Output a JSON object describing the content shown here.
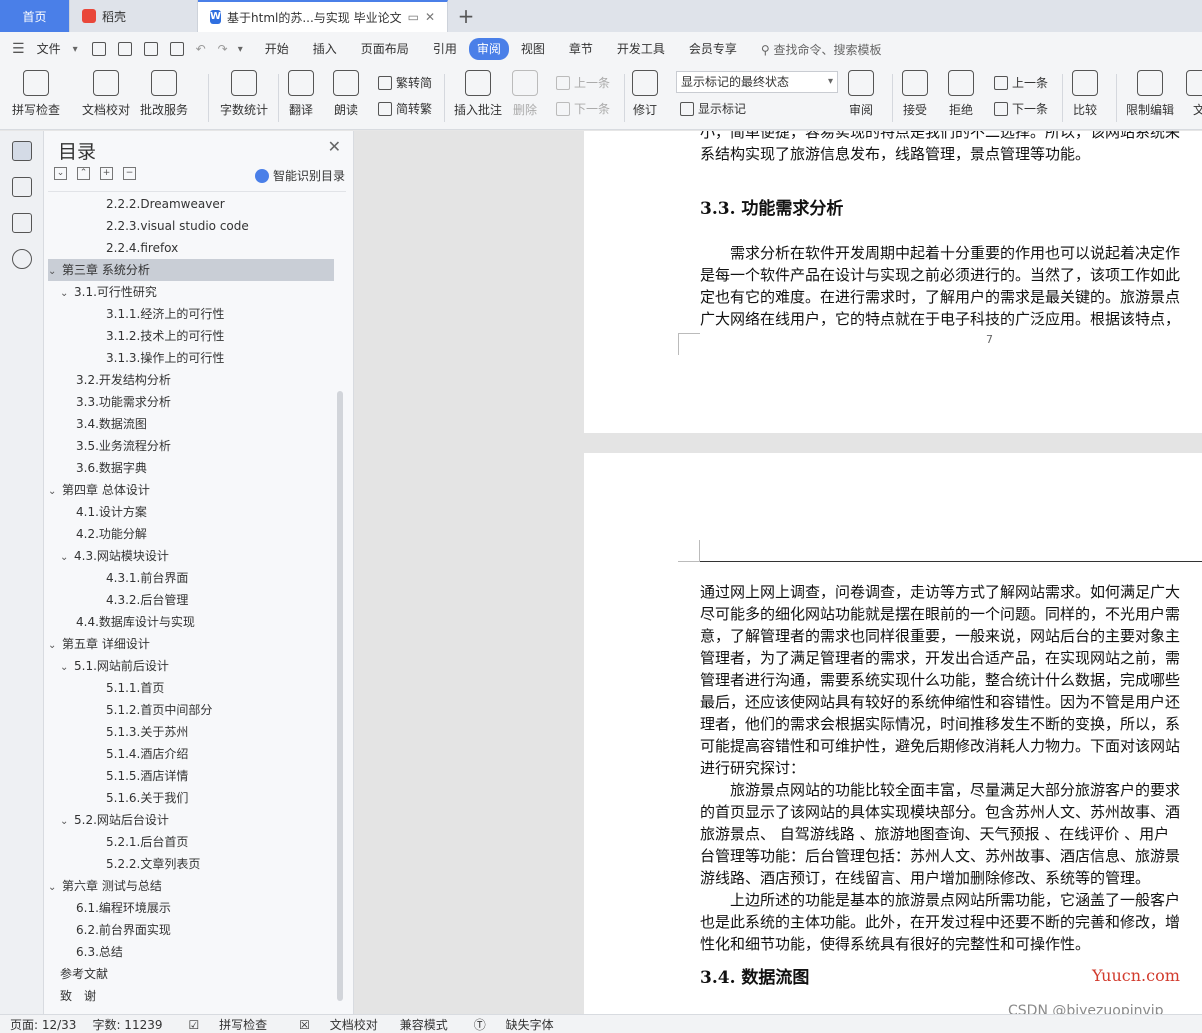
{
  "tabs": {
    "home": "首页",
    "daoke": "稻壳",
    "doc": "基于html的苏...与实现 毕业论文",
    "new": "+"
  },
  "menu": {
    "file": "文件",
    "items": [
      "开始",
      "插入",
      "页面布局",
      "引用",
      "审阅",
      "视图",
      "章节",
      "开发工具",
      "会员专享"
    ],
    "active": "审阅",
    "search": "查找命令、搜索模板"
  },
  "ribbon": {
    "spell": "拼写检查",
    "proof": "文档校对",
    "annotate": "批改服务",
    "wordcount": "字数统计",
    "translate": "翻译",
    "read": "朗读",
    "to_trad": "繁转简",
    "to_simp": "简转繁",
    "insert_comment": "插入批注",
    "delete": "删除",
    "prev1": "上一条",
    "next1": "下一条",
    "revise": "修订",
    "display_select": "显示标记的最终状态",
    "show_marks": "显示标记",
    "review": "审阅",
    "accept": "接受",
    "reject": "拒绝",
    "prev2": "上一条",
    "next2": "下一条",
    "compare": "比较",
    "restrict": "限制编辑",
    "doc_cut": "文"
  },
  "toc": {
    "title": "目录",
    "smart": "智能识别目录",
    "items": [
      {
        "label": "2.2.2.Dreamweaver",
        "level": 3
      },
      {
        "label": "2.2.3.visual studio code",
        "level": 3
      },
      {
        "label": "2.2.4.firefox",
        "level": 3
      },
      {
        "label": "第三章 系统分析",
        "level": 1,
        "selected": true,
        "arrow": "⌄"
      },
      {
        "label": "3.1.可行性研究",
        "level": 2,
        "arrow": "⌄"
      },
      {
        "label": "3.1.1.经济上的可行性",
        "level": 3
      },
      {
        "label": "3.1.2.技术上的可行性",
        "level": 3
      },
      {
        "label": "3.1.3.操作上的可行性",
        "level": 3
      },
      {
        "label": "3.2.开发结构分析",
        "level": 2
      },
      {
        "label": "3.3.功能需求分析",
        "level": 2
      },
      {
        "label": "3.4.数据流图",
        "level": 2
      },
      {
        "label": "3.5.业务流程分析",
        "level": 2
      },
      {
        "label": "3.6.数据字典",
        "level": 2
      },
      {
        "label": "第四章 总体设计",
        "level": 1,
        "arrow": "⌄"
      },
      {
        "label": "4.1.设计方案",
        "level": 2
      },
      {
        "label": "4.2.功能分解",
        "level": 2
      },
      {
        "label": "4.3.网站模块设计",
        "level": 2,
        "arrow": "⌄"
      },
      {
        "label": "4.3.1.前台界面",
        "level": 3
      },
      {
        "label": "4.3.2.后台管理",
        "level": 3
      },
      {
        "label": "4.4.数据库设计与实现",
        "level": 2
      },
      {
        "label": "第五章 详细设计",
        "level": 1,
        "arrow": "⌄"
      },
      {
        "label": "5.1.网站前后设计",
        "level": 2,
        "arrow": "⌄"
      },
      {
        "label": "5.1.1.首页",
        "level": 3
      },
      {
        "label": "5.1.2.首页中间部分",
        "level": 3
      },
      {
        "label": "5.1.3.关于苏州",
        "level": 3
      },
      {
        "label": "5.1.4.酒店介绍",
        "level": 3
      },
      {
        "label": "5.1.5.酒店详情",
        "level": 3
      },
      {
        "label": "5.1.6.关于我们",
        "level": 3
      },
      {
        "label": "5.2.网站后台设计",
        "level": 2,
        "arrow": "⌄"
      },
      {
        "label": "5.2.1.后台首页",
        "level": 3
      },
      {
        "label": "5.2.2.文章列表页",
        "level": 3
      },
      {
        "label": "第六章 测试与总结",
        "level": 1,
        "arrow": "⌄"
      },
      {
        "label": "6.1.编程环境展示",
        "level": 2
      },
      {
        "label": "6.2.前台界面实现",
        "level": 2
      },
      {
        "label": "6.3.总结",
        "level": 2
      },
      {
        "label": "参考文献",
        "level": 1
      },
      {
        "label": "致　谢",
        "level": 1
      }
    ]
  },
  "doc": {
    "p1_line0": "小，简单便捷，容易实现的特点是我们的不二选择。所以，该网站系统采",
    "p1_line1": "系结构实现了旅游信息发布，线路管理，景点管理等功能。",
    "h33": "3.3.  功能需求分析",
    "p1_body": [
      "　　需求分析在软件开发周期中起着十分重要的作用也可以说起着决定作",
      "是每一个软件产品在设计与实现之前必须进行的。当然了，该项工作如此",
      "定也有它的难度。在进行需求时，了解用户的需求是最关键的。旅游景点",
      "广大网络在线用户，它的特点就在于电子科技的广泛应用。根据该特点，"
    ],
    "page_number": "7",
    "p2_body": [
      "通过网上网上调查，问卷调查，走访等方式了解网站需求。如何满足广大",
      "尽可能多的细化网站功能就是摆在眼前的一个问题。同样的，不光用户需",
      "意，了解管理者的需求也同样很重要，一般来说，网站后台的主要对象主",
      "管理者，为了满足管理者的需求，开发出合适产品，在实现网站之前，需",
      "管理者进行沟通，需要系统实现什么功能，整合统计什么数据，完成哪些",
      "最后，还应该使网站具有较好的系统伸缩性和容错性。因为不管是用户还",
      "理者，他们的需求会根据实际情况，时间推移发生不断的变换，所以，系",
      "可能提高容错性和可维护性，避免后期修改消耗人力物力。下面对该网站",
      "进行研究探讨：",
      "　　旅游景点网站的功能比较全面丰富，尽量满足大部分旅游客户的要求",
      "的首页显示了该网站的具体实现模块部分。包含苏州人文、苏州故事、酒",
      "旅游景点、 自驾游线路 、旅游地图查询、天气预报 、在线评价 、用户",
      "台管理等功能：后台管理包括：苏州人文、苏州故事、酒店信息、旅游景",
      "游线路、酒店预订，在线留言、用户增加删除修改、系统等的管理。",
      "　　上边所述的功能是基本的旅游景点网站所需功能，它涵盖了一般客户",
      "也是此系统的主体功能。此外，在开发过程中还要不断的完善和修改，增",
      "性化和细节功能，使得系统具有很好的完整性和可操作性。"
    ],
    "h34": "3.4.  数据流图"
  },
  "status": {
    "page": "页面: 12/33",
    "words": "字数: 11239",
    "spell": "拼写检查",
    "proof": "文档校对",
    "compat": "兼容模式",
    "missing_font": "缺失字体"
  },
  "watermark": "Yuucn.com",
  "csdn": "CSDN @biyezuopinvip"
}
